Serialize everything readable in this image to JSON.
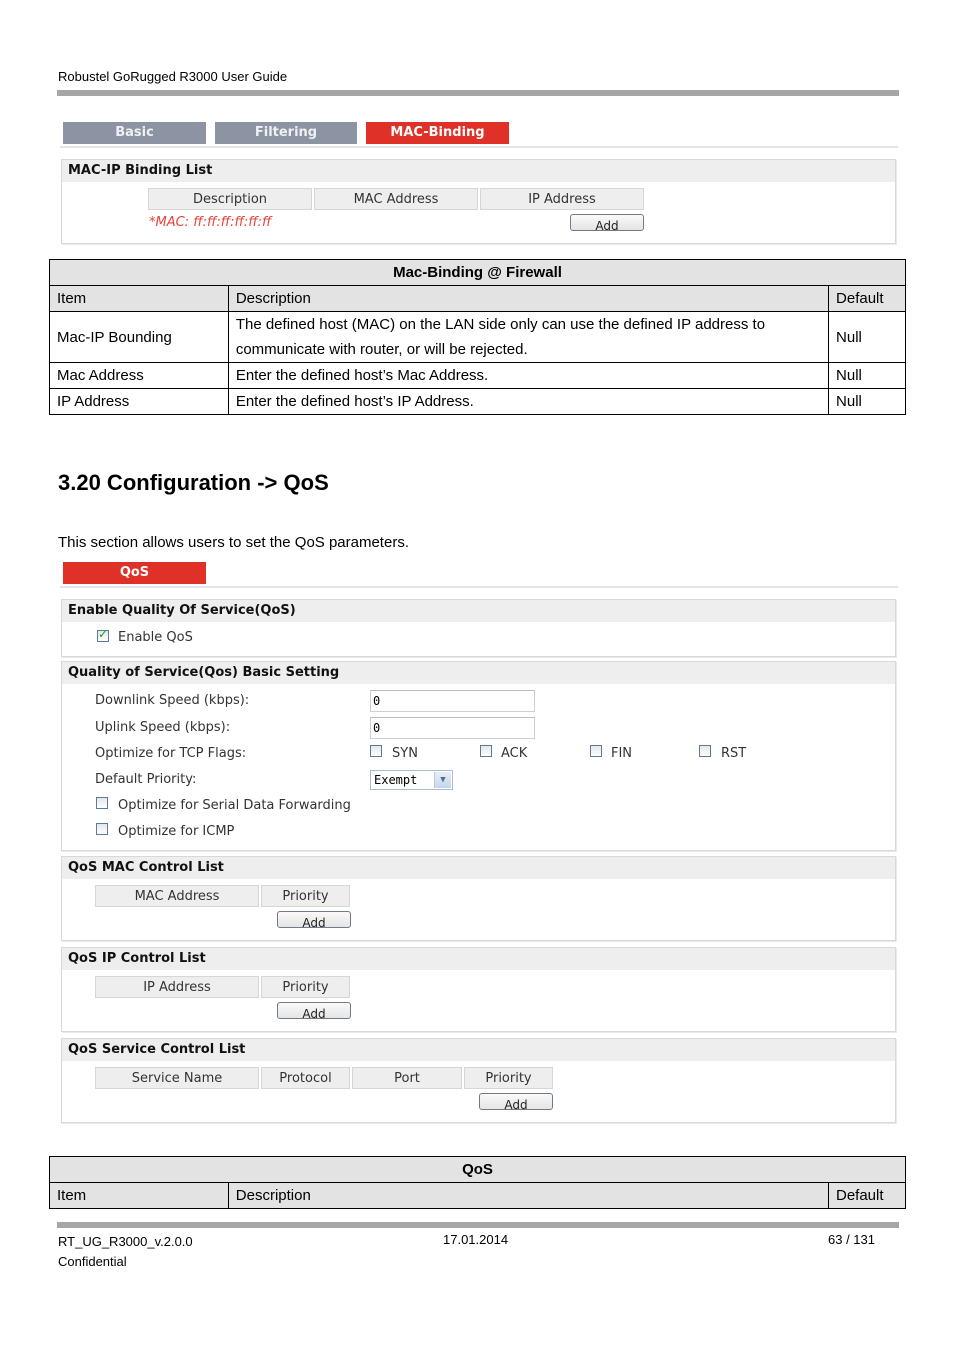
{
  "document": {
    "header_title": "Robustel GoRugged R3000 User Guide",
    "footer": {
      "doc_id": "RT_UG_R3000_v.2.0.0",
      "classification": "Confidential",
      "date": "17.01.2014",
      "page": "63 / 131"
    }
  },
  "mac_binding_ui": {
    "tabs": [
      {
        "label": "Basic",
        "active": false
      },
      {
        "label": "Filtering",
        "active": false
      },
      {
        "label": "MAC-Binding",
        "active": true
      }
    ],
    "panel_title": "MAC-IP Binding List",
    "columns": [
      "Description",
      "MAC Address",
      "IP Address"
    ],
    "note": "*MAC: ff:ff:ff:ff:ff:ff",
    "add_label": "Add"
  },
  "mac_binding_table": {
    "title": "Mac-Binding @ Firewall",
    "headers": [
      "Item",
      "Description",
      "Default"
    ],
    "rows": [
      {
        "item": "Mac-IP Bounding",
        "description": "The defined host (MAC) on the LAN side only can use the defined IP address to communicate with router, or will be rejected.",
        "default": "Null"
      },
      {
        "item": "Mac Address",
        "description": "Enter the defined host’s Mac Address.",
        "default": "Null"
      },
      {
        "item": "IP Address",
        "description": "Enter the defined host’s IP Address.",
        "default": "Null"
      }
    ]
  },
  "section": {
    "title": "3.20  Configuration -> QoS",
    "intro": "This section allows users to set the QoS parameters."
  },
  "qos_ui": {
    "tab_label": "QoS",
    "enable_panel": {
      "title": "Enable Quality Of Service(QoS)",
      "enable_label": "Enable QoS",
      "enable_checked": true
    },
    "basic_panel": {
      "title": "Quality of Service(Qos) Basic Setting",
      "downlink_label": "Downlink Speed (kbps):",
      "downlink_value": "0",
      "uplink_label": "Uplink Speed (kbps):",
      "uplink_value": "0",
      "tcp_flags_label": "Optimize for TCP Flags:",
      "tcp_flags": [
        {
          "label": "SYN",
          "checked": false
        },
        {
          "label": "ACK",
          "checked": false
        },
        {
          "label": "FIN",
          "checked": false
        },
        {
          "label": "RST",
          "checked": false
        }
      ],
      "priority_label": "Default Priority:",
      "priority_value": "Exempt",
      "serial_label": "Optimize for Serial Data Forwarding",
      "serial_checked": false,
      "icmp_label": "Optimize for ICMP",
      "icmp_checked": false
    },
    "mac_list": {
      "title": "QoS MAC Control List",
      "columns": [
        "MAC Address",
        "Priority"
      ],
      "add_label": "Add"
    },
    "ip_list": {
      "title": "QoS IP Control List",
      "columns": [
        "IP Address",
        "Priority"
      ],
      "add_label": "Add"
    },
    "service_list": {
      "title": "QoS Service Control List",
      "columns": [
        "Service Name",
        "Protocol",
        "Port",
        "Priority"
      ],
      "add_label": "Add"
    }
  },
  "qos_table": {
    "title": "QoS",
    "headers": [
      "Item",
      "Description",
      "Default"
    ]
  },
  "colors": {
    "active_tab": "#e03128",
    "inactive_tab": "#8c94a3",
    "note_red": "#e8423a",
    "panel_header": "#eeeeee",
    "rule_gray": "#a6a6a6"
  }
}
